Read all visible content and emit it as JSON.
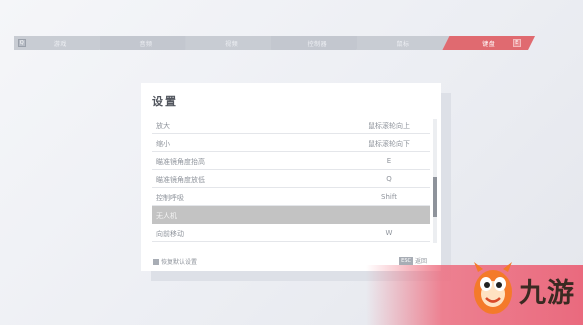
{
  "tabs": [
    {
      "label": "游戏"
    },
    {
      "label": "音频"
    },
    {
      "label": "视频"
    },
    {
      "label": "控制器"
    },
    {
      "label": "鼠标"
    },
    {
      "label": "键盘"
    }
  ],
  "tabbar": {
    "left_key": "Q",
    "right_key": "E"
  },
  "panel": {
    "title": "设置",
    "rows": [
      {
        "action": "放大",
        "key": "鼠标滚轮向上"
      },
      {
        "action": "缩小",
        "key": "鼠标滚轮向下"
      },
      {
        "action": "瞄准镜角度抬高",
        "key": "E"
      },
      {
        "action": "瞄准镜角度放低",
        "key": "Q"
      },
      {
        "action": "控制呼吸",
        "key": "Shift"
      },
      {
        "action": "无人机",
        "key": ""
      },
      {
        "action": "向前移动",
        "key": "W"
      }
    ],
    "reset_label": "恢复默认设置",
    "back_key": "ESC",
    "back_label": "返回"
  },
  "watermark": {
    "brand": "九游"
  },
  "colors": {
    "active_tab": "#e06a70",
    "selected_row": "#c3c3c3"
  }
}
